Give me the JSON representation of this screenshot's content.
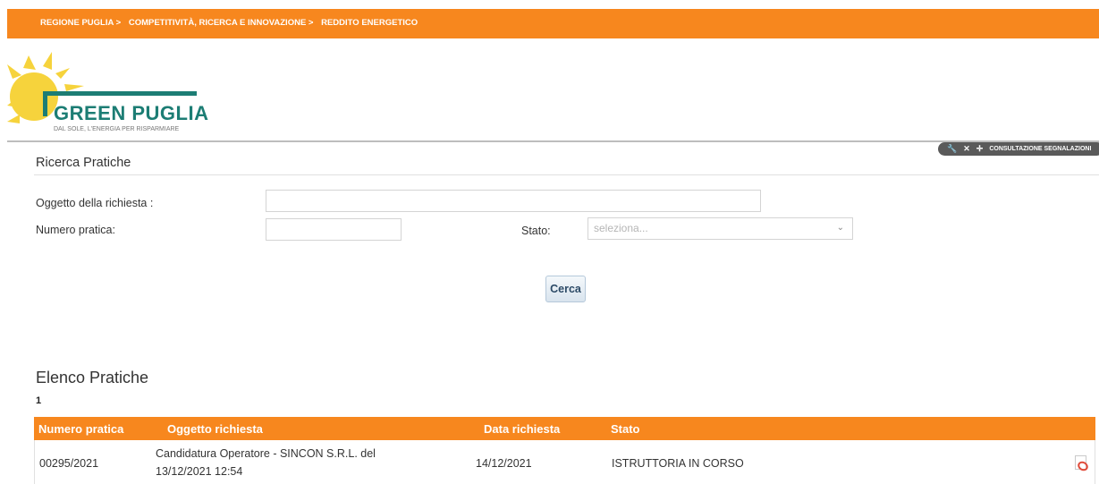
{
  "breadcrumb": [
    "REGIONE PUGLIA >",
    "COMPETITIVITÀ, RICERCA E INNOVAZIONE >",
    "REDDITO ENERGETICO"
  ],
  "logo": {
    "title": "GREEN PUGLIA",
    "subtitle": "DAL SOLE, L'ENERGIA PER RISPARMIARE"
  },
  "toolbar": {
    "label": "CONSULTAZIONE SEGNALAZIONI",
    "icons": [
      "wrench-icon",
      "close-icon",
      "move-icon"
    ]
  },
  "search": {
    "title": "Ricerca Pratiche",
    "oggetto_label": "Oggetto della richiesta :",
    "oggetto_value": "",
    "numero_label": "Numero pratica:",
    "numero_value": "",
    "stato_label": "Stato:",
    "stato_placeholder": "seleziona...",
    "button": "Cerca"
  },
  "list": {
    "title": "Elenco Pratiche",
    "count": "1",
    "columns": [
      "Numero pratica",
      "Oggetto richiesta",
      "Data richiesta",
      "Stato"
    ],
    "rows": [
      {
        "numero": "00295/2021",
        "oggetto_line1": "Candidatura Operatore - SINCON S.R.L. del",
        "oggetto_line2": "13/12/2021 12:54",
        "data": "14/12/2021",
        "stato": "ISTRUTTORIA IN CORSO",
        "icon": "pdf-icon"
      }
    ]
  },
  "colors": {
    "accent": "#f7871e",
    "logo_green": "#1c7d74",
    "sun_yellow": "#f6d33c"
  }
}
